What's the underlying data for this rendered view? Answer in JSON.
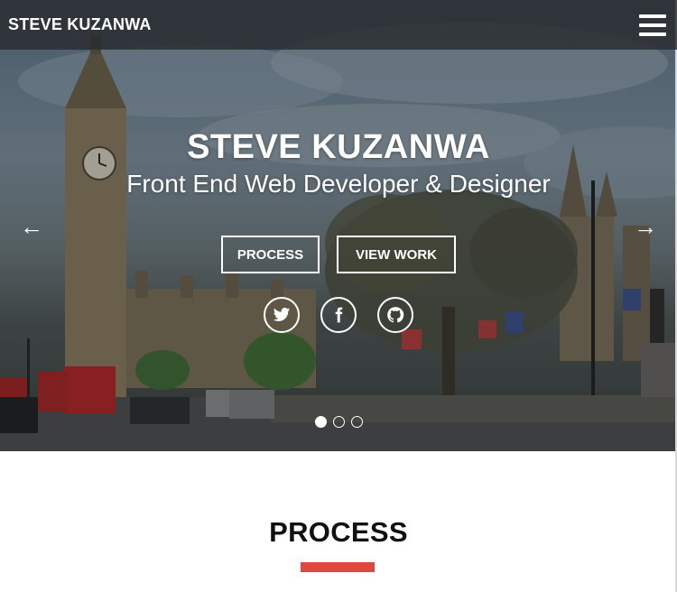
{
  "navbar": {
    "brand": "STEVE KUZANWA",
    "menu_icon": "hamburger-menu-icon"
  },
  "hero": {
    "title": "STEVE KUZANWA",
    "subtitle": "Front End Web Developer & Designer",
    "buttons": {
      "process": "PROCESS",
      "view_work": "VIEW WORK"
    },
    "social_icons": [
      "twitter-icon",
      "facebook-icon",
      "github-icon"
    ],
    "prev_arrow": "←",
    "next_arrow": "→",
    "slide_count": 3,
    "active_slide": 1
  },
  "process": {
    "title": "PROCESS"
  },
  "colors": {
    "accent": "#e0473d",
    "hero_overlay": "#282c2e",
    "text_dark": "#111111"
  }
}
